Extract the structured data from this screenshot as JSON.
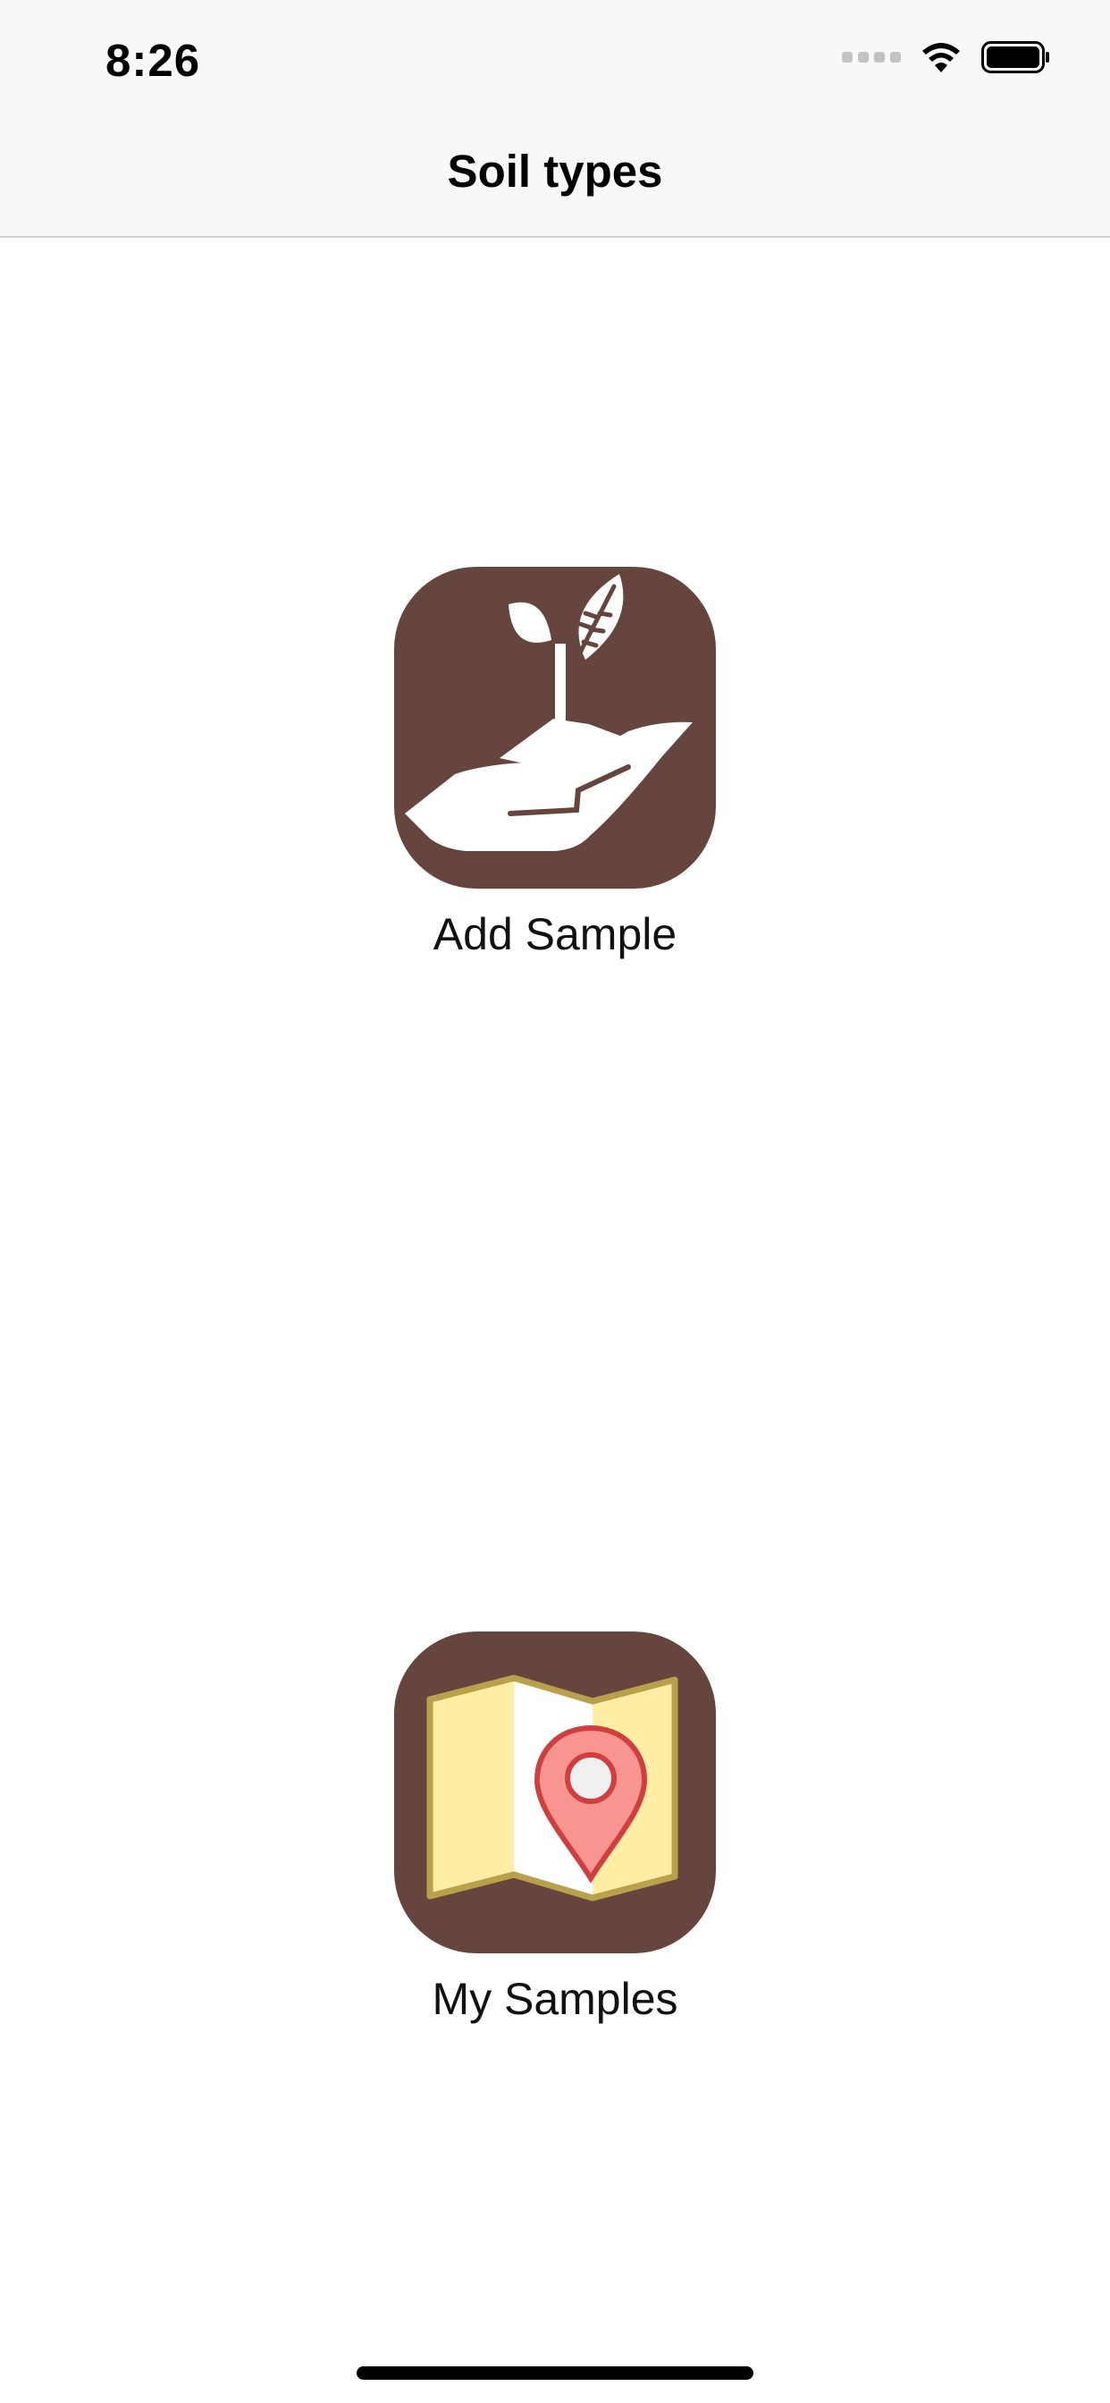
{
  "status_bar": {
    "time": "8:26",
    "signal_icon": "cellular-signal-icon",
    "wifi_icon": "wifi-icon",
    "battery_icon": "battery-icon"
  },
  "nav": {
    "title": "Soil types"
  },
  "launchers": {
    "add_sample": {
      "label": "Add Sample",
      "icon": "plant-in-hand-icon"
    },
    "my_samples": {
      "label": "My Samples",
      "icon": "map-pin-icon"
    }
  },
  "colors": {
    "tile_background": "#65453d",
    "nav_background": "#f8f8f8",
    "map_paper": "#ffeea3",
    "map_border": "#b9a04a",
    "pin_fill": "#f89590",
    "pin_stroke": "#cf3f3f"
  }
}
